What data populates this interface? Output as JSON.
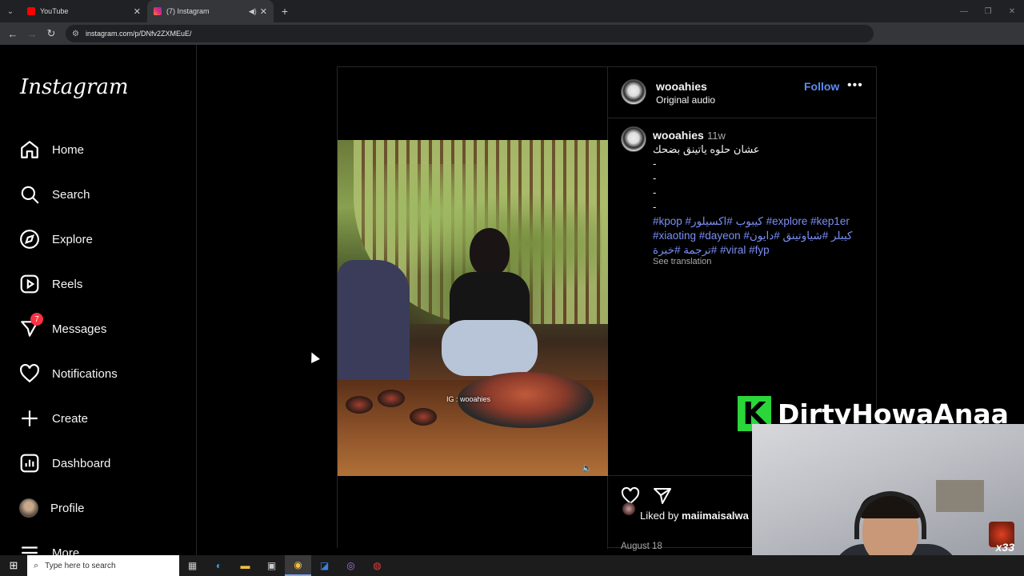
{
  "browser": {
    "tabs": [
      {
        "title": "YouTube",
        "favicon_color": "#ff0000"
      },
      {
        "title": "(7) Instagram",
        "favicon_color": "#d6249f"
      }
    ],
    "url": "instagram.com/p/DNfv2ZXMEuE/"
  },
  "sidebar": {
    "logo": "Instagram",
    "items": [
      {
        "label": "Home",
        "icon": "home-icon"
      },
      {
        "label": "Search",
        "icon": "search-icon"
      },
      {
        "label": "Explore",
        "icon": "compass-icon"
      },
      {
        "label": "Reels",
        "icon": "reels-icon"
      },
      {
        "label": "Messages",
        "icon": "messenger-icon",
        "badge": "7"
      },
      {
        "label": "Notifications",
        "icon": "heart-icon"
      },
      {
        "label": "Create",
        "icon": "plus-icon"
      },
      {
        "label": "Dashboard",
        "icon": "chart-icon"
      },
      {
        "label": "Profile",
        "icon": "avatar"
      },
      {
        "label": "More",
        "icon": "menu-icon"
      }
    ]
  },
  "post": {
    "username": "wooahies",
    "audio": "Original audio",
    "follow_label": "Follow",
    "more_label": "•••",
    "video_caption": "IG : wooahies",
    "comment": {
      "username": "wooahies",
      "time": "11w",
      "text": "عشان حلوه ياتينق بضحك",
      "dashes": [
        "-",
        "-",
        "-",
        "-"
      ],
      "hashtags": "#kpop #كيبوب #اكسيلور #explore #kep1er #xiaoting #dayeon #كيبلر #شياوتينق #دايون #ترجمة #خبرة #viral #fyp",
      "see_translation": "See translation"
    },
    "liked_by_prefix": "Liked by ",
    "liked_by_user": "maiimaisalwa",
    "date": "August 18"
  },
  "stream_overlay": {
    "logo_letter": "K",
    "channel_name": "DirtyHowaAnaa",
    "mini_badge": "x33",
    "brand_color": "#2bd63a"
  },
  "taskbar": {
    "search_placeholder": "Type here to search"
  }
}
